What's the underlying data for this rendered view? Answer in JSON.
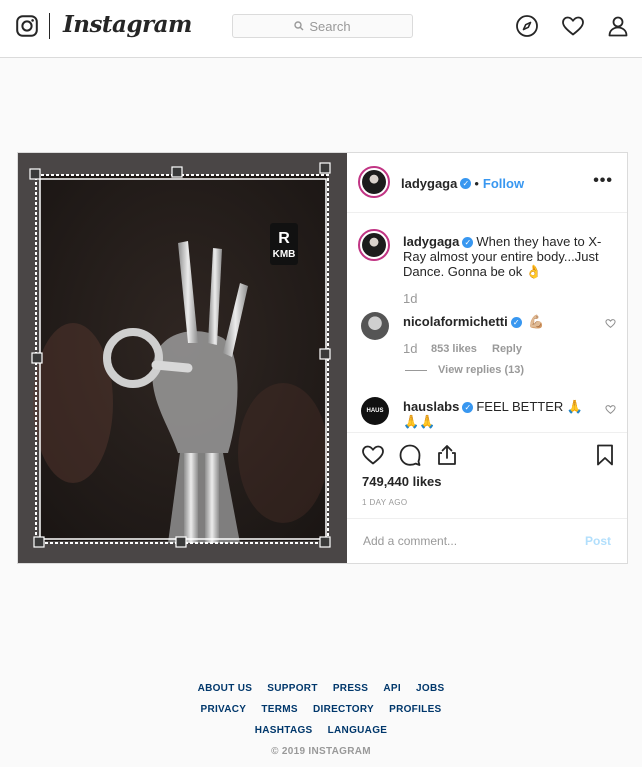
{
  "header": {
    "logo_text": "Instagram",
    "search_placeholder": "Search",
    "icons": [
      "instagram-glyph-icon",
      "compass-icon",
      "heart-icon",
      "profile-icon"
    ]
  },
  "post": {
    "author": "ladygaga",
    "follow_label": "Follow",
    "more_label": "•••",
    "photo_badge": "R",
    "photo_badge_sub": "KMB",
    "caption": {
      "user": "ladygaga",
      "text": "When they have to X-Ray almost your entire body...Just Dance. Gonna be ok 👌",
      "age": "1d"
    },
    "comments": [
      {
        "user": "nicolaformichetti",
        "text": "💪🏼",
        "age": "1d",
        "likes": "853 likes",
        "reply_label": "Reply",
        "view_replies": "View replies (13)"
      },
      {
        "user": "hauslabs",
        "text": "FEEL BETTER 🙏🙏🙏",
        "avatar_text": "HAUS"
      }
    ],
    "likes": "749,440 likes",
    "posted": "1 DAY AGO",
    "add_comment_placeholder": "Add a comment...",
    "post_label": "Post"
  },
  "footer": {
    "row1": [
      "ABOUT US",
      "SUPPORT",
      "PRESS",
      "API",
      "JOBS"
    ],
    "row2": [
      "PRIVACY",
      "TERMS",
      "DIRECTORY",
      "PROFILES"
    ],
    "row3": [
      "HASHTAGS",
      "LANGUAGE"
    ],
    "copyright": "© 2019 INSTAGRAM"
  },
  "colors": {
    "accent": "#3897f0",
    "story_ring": "#c13584",
    "footer_link": "#00376b"
  }
}
